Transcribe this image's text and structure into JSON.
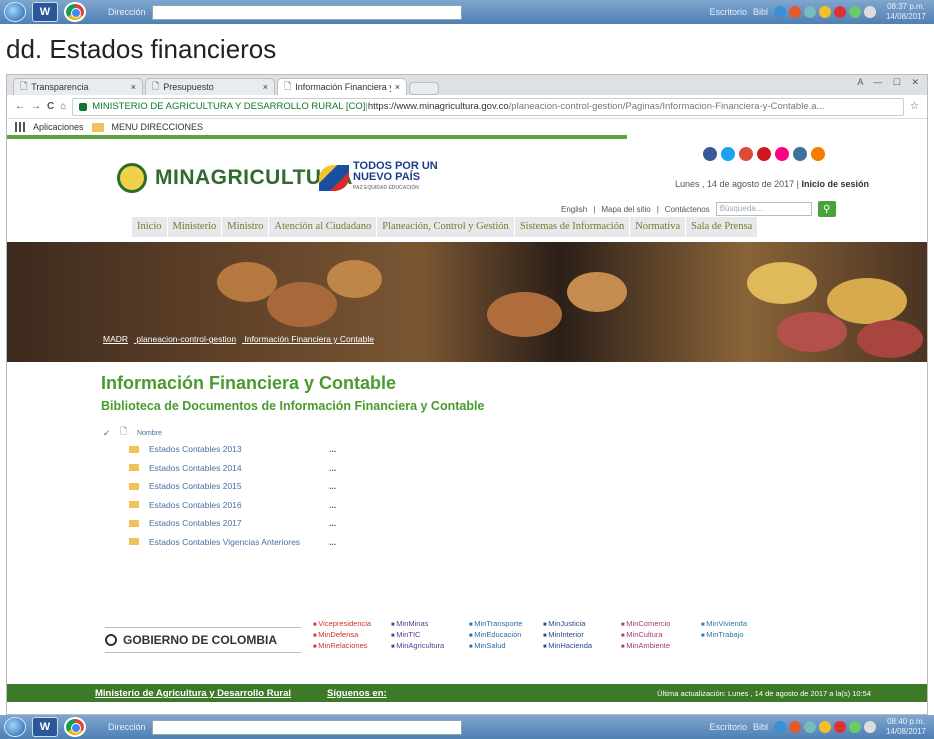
{
  "taskbar_top": {
    "address_label": "Dirección",
    "search_label": "Escritorio",
    "bibl_label": "Bibl",
    "time": "08:37 p.m.",
    "date": "14/08/2017"
  },
  "taskbar_bottom": {
    "address_label": "Dirección",
    "search_label": "Escritorio",
    "bibl_label": "Bibl",
    "time": "08:40 p.m.",
    "date": "14/08/2017"
  },
  "heading": "dd. Estados financieros",
  "tabs": [
    {
      "label": "Transparencia"
    },
    {
      "label": "Presupuesto"
    },
    {
      "label": "Información Financiera y"
    }
  ],
  "tab_close": "×",
  "window_controls": "A  —  ☐  ✕",
  "nav_buttons": {
    "back": "←",
    "forward": "→",
    "reload": "C",
    "home": "⌂",
    "star": "☆"
  },
  "url": {
    "secure": "MINISTERIO DE AGRICULTURA Y DESARROLLO RURAL [CO]",
    "sep": " | ",
    "domain": "https://www.minagricultura.gov.co",
    "path": "/planeacion-control-gestion/Paginas/Informacion-Financiera-y-Contable.a..."
  },
  "bookmarks": {
    "apps": "Aplicaciones",
    "menu": "MENU DIRECCIONES"
  },
  "site": {
    "logo": "MINAGRICULTURA",
    "gov_line1": "TODOS POR UN",
    "gov_line2": "NUEVO PAÍS",
    "gov_tag": "PAZ  EQUIDAD  EDUCACIÓN",
    "date": "Lunes , 14 de agosto de 2017",
    "login": "Inicio de sesión",
    "util": [
      "English",
      "Mapa del sitio",
      "Contáctenos"
    ],
    "search_placeholder": "Búsqueda...",
    "nav": [
      "Inicio",
      "Ministerio",
      "Ministro",
      "Atención al Ciudadano",
      "Planeación, Control y Gestión",
      "Sistemas de Información",
      "Normativa",
      "Sala de Prensa"
    ],
    "breadcrumb": [
      "MADR",
      "planeacion-control-gestion",
      "Información Financiera y Contable"
    ],
    "title": "Información Financiera y Contable",
    "subtitle": "Biblioteca de Documentos de Información Financiera y Contable",
    "col_name": "Nombre",
    "docs": [
      {
        "name": "Estados Contables 2013",
        "more": "..."
      },
      {
        "name": "Estados Contables 2014",
        "more": "..."
      },
      {
        "name": "Estados Contables 2015",
        "more": "..."
      },
      {
        "name": "Estados Contables 2016",
        "more": "..."
      },
      {
        "name": "Estados Contables 2017",
        "more": "..."
      },
      {
        "name": "Estados Contables Vigencias Anteriores",
        "more": "..."
      }
    ],
    "gobierno": "GOBIERNO DE COLOMBIA",
    "ministries": [
      [
        "Vicepresidencia",
        "MinDefensa",
        "MinRelaciones"
      ],
      [
        "MinMinas",
        "MinTIC",
        "MinAgricultura"
      ],
      [
        "MinTransporte",
        "MinEducación",
        "MinSalud"
      ],
      [
        "MinJusticia",
        "MinInterior",
        "MinHacienda"
      ],
      [
        "MinComercio",
        "MinCultura",
        "MinAmbiente"
      ],
      [
        "MinVivienda",
        "MinTrabajo"
      ]
    ],
    "footer_ministry": "Ministerio de Agricultura y Desarrollo Rural",
    "footer_follow": "Síguenos en:",
    "footer_update": "Última actualización: Lunes , 14 de agosto de 2017 a la(s) 10:54"
  },
  "colors": {
    "green": "#4a9a2f",
    "footer": "#3d7a28",
    "nav_text": "#6e7f2f"
  }
}
